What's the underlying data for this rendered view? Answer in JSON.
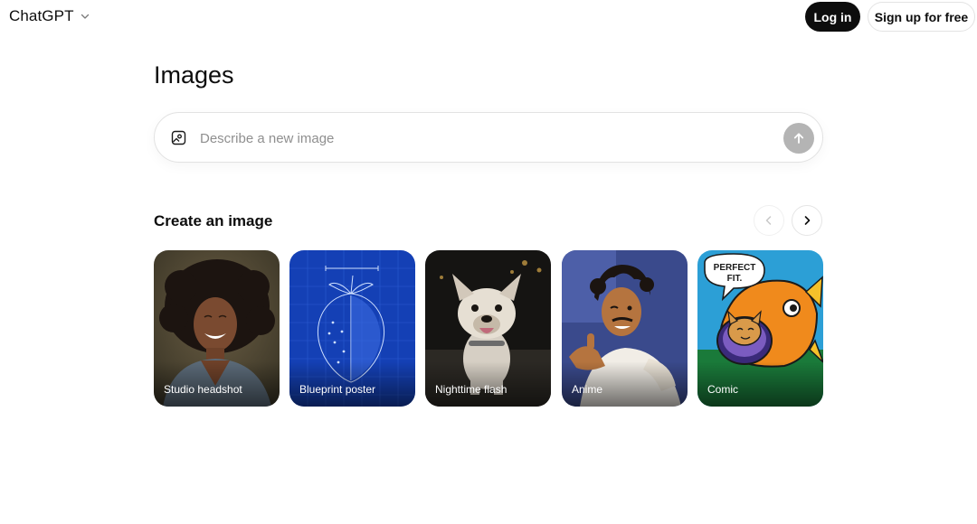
{
  "header": {
    "brand": "ChatGPT",
    "login_label": "Log in",
    "signup_label": "Sign up for free"
  },
  "main": {
    "title": "Images",
    "prompt": {
      "placeholder": "Describe a new image",
      "value": ""
    },
    "section_title": "Create an image",
    "cards": [
      {
        "label": "Studio headshot"
      },
      {
        "label": "Blueprint poster"
      },
      {
        "label": "Nighttime flash"
      },
      {
        "label": "Anime"
      },
      {
        "label": "Comic",
        "bubble_text_1": "PERFECT",
        "bubble_text_2": "FIT."
      }
    ]
  },
  "icons": {
    "brand_menu": "chevron-down-icon",
    "prompt": "image-icon",
    "send": "arrow-up-icon",
    "carousel_prev": "chevron-left-icon",
    "carousel_next": "chevron-right-icon"
  },
  "colors": {
    "primary_button": "#0d0d0d",
    "send_button": "#b4b4b4",
    "text": "#0d0d0d",
    "placeholder": "#8f8f8f"
  }
}
